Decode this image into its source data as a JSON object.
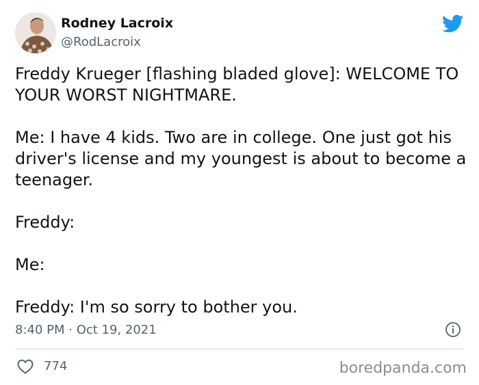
{
  "author": {
    "display_name": "Rodney Lacroix",
    "handle": "@RodLacroix",
    "avatar_icon": "profile-photo"
  },
  "brand": {
    "logo_icon": "twitter-bird-icon",
    "accent_color": "#1d9bf0"
  },
  "tweet": {
    "paragraphs": [
      "Freddy Krueger [flashing bladed glove]: WELCOME TO YOUR WORST NIGHTMARE.",
      "Me: I have 4 kids. Two are in college. One just got his driver's license and my youngest is about to become a teenager.",
      "Freddy:",
      "Me:",
      "Freddy: I'm so sorry to bother you."
    ],
    "timestamp": "8:40 PM · Oct 19, 2021"
  },
  "engagement": {
    "likes": "774",
    "like_icon": "heart-outline-icon",
    "info_icon": "info-circle-icon"
  },
  "watermark": "boredpanda.com"
}
